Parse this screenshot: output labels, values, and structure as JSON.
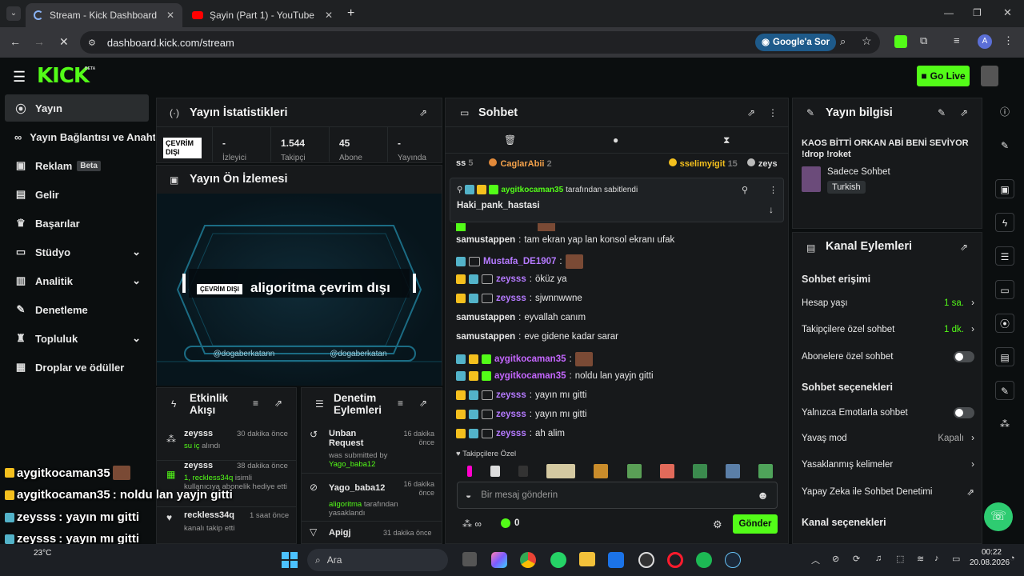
{
  "browser": {
    "tabs": [
      {
        "title": "Stream - Kick Dashboard"
      },
      {
        "title": "Şayin (Part 1) - YouTube"
      }
    ],
    "url": "dashboard.kick.com/stream",
    "google_btn": "Google'a Sor",
    "profile_initial": "A"
  },
  "header": {
    "logo": "KICK",
    "logo_sup": "BETA",
    "go_live": "Go Live"
  },
  "sidebar": {
    "items": [
      {
        "label": "Yayın"
      },
      {
        "label": "Yayın Bağlantısı ve Anahtarı"
      },
      {
        "label": "Reklam",
        "badge": "Beta"
      },
      {
        "label": "Gelir"
      },
      {
        "label": "Başarılar"
      },
      {
        "label": "Stüdyo"
      },
      {
        "label": "Analitik"
      },
      {
        "label": "Denetleme"
      },
      {
        "label": "Topluluk"
      },
      {
        "label": "Droplar ve ödüller"
      }
    ]
  },
  "stats": {
    "title": "Yayın İstatistikleri",
    "status_badge": "ÇEVRİM DIŞI",
    "cells": [
      {
        "value": "-",
        "label": "İzleyici"
      },
      {
        "value": "1.544",
        "label": "Takipçi"
      },
      {
        "value": "45",
        "label": "Abone"
      },
      {
        "value": "-",
        "label": "Yayında"
      }
    ]
  },
  "preview": {
    "title": "Yayın Ön İzlemesi",
    "badge": "ÇEVRİM DIŞI",
    "offline_text": "aligoritma çevrim dışı",
    "social_twitter": "@dogaberkatann",
    "social_instagram": "@dogaberkatan"
  },
  "activity": {
    "title": "Etkinlik Akışı",
    "items": [
      {
        "user": "zeysss",
        "time": "30 dakika önce",
        "desc_green": "su iç",
        "desc": " alındı"
      },
      {
        "user": "zeysss",
        "time": "38 dakika önce",
        "desc_green": "1, reckless34q",
        "desc": " isimli kullanıcıya abonelik hediye etti"
      },
      {
        "user": "reckless34q",
        "time": "1 saat önce",
        "desc_green": "",
        "desc": "kanalı takip etti"
      }
    ]
  },
  "moderation": {
    "title": "Denetim Eylemleri",
    "items": [
      {
        "title": "Unban Request",
        "time": "16 dakika önce",
        "desc": "was submitted by",
        "desc_green": "Yago_baba12"
      },
      {
        "title": "Yago_baba12",
        "time": "16 dakika önce",
        "desc_green": "aligoritma",
        "desc": " tarafından yasaklandı"
      },
      {
        "title": "Apigj",
        "time": "31 dakika önce"
      }
    ]
  },
  "chat": {
    "title": "Sohbet",
    "top_users": [
      {
        "name": "ss",
        "count": "5"
      },
      {
        "name": "CaglarAbii",
        "count": "2"
      },
      {
        "name": "sselimyigit",
        "count": "15"
      },
      {
        "name": "zeys",
        "count": ""
      }
    ],
    "pinned_by": "aygitkocaman35",
    "pinned_suffix": " tarafından sabitlendi",
    "pinned_text": "Haki_pank_hastasi",
    "messages": [
      {
        "user": "samustappen",
        "text": "tam ekran yap lan konsol ekranı ufak",
        "color": "#e6e6e6"
      },
      {
        "user": "Mustafa_DE1907",
        "text": "",
        "color": "#b57aff"
      },
      {
        "user": "zeysss",
        "text": "öküz ya",
        "color": "#b57aff"
      },
      {
        "user": "zeysss",
        "text": "sjwnnwwne",
        "color": "#b57aff"
      },
      {
        "user": "samustappen",
        "text": "eyvallah canım",
        "color": "#e6e6e6"
      },
      {
        "user": "samustappen",
        "text": "eve gidene kadar sarar",
        "color": "#e6e6e6"
      },
      {
        "user": "aygitkocaman35",
        "text": "",
        "color": "#c567ff"
      },
      {
        "user": "aygitkocaman35",
        "text": "noldu lan yayjn gitti",
        "color": "#c567ff"
      },
      {
        "user": "zeysss",
        "text": "yayın mı gitti",
        "color": "#b57aff"
      },
      {
        "user": "zeysss",
        "text": "yayın mı gitti",
        "color": "#b57aff"
      },
      {
        "user": "zeysss",
        "text": "ah alim",
        "color": "#b57aff"
      }
    ],
    "emote_label": "Takipçilere Özel",
    "input_placeholder": "Bir mesaj gönderin",
    "points": "0",
    "send": "Gönder"
  },
  "stream_info": {
    "title": "Yayın bilgisi",
    "stream_title": "KAOS BİTTİ ORKAN ABİ BENİ SEVİYOR !drop !roket",
    "category": "Sadece Sohbet",
    "tag": "Turkish"
  },
  "channel_actions": {
    "title": "Kanal Eylemleri",
    "chat_access": "Sohbet erişimi",
    "rows1": [
      {
        "label": "Hesap yaşı",
        "value": "1 sa."
      },
      {
        "label": "Takipçilere özel sohbet",
        "value": "1 dk."
      },
      {
        "label": "Abonelere özel sohbet",
        "value": ""
      }
    ],
    "chat_options": "Sohbet seçenekleri",
    "rows2": [
      {
        "label": "Yalnızca Emotlarla sohbet",
        "value": ""
      },
      {
        "label": "Yavaş mod",
        "value": "Kapalı"
      },
      {
        "label": "Yasaklanmış kelimeler",
        "value": ""
      },
      {
        "label": "Yapay Zeka ile Sohbet Denetimi",
        "value": ""
      }
    ],
    "channel_options": "Kanal seçenekleri"
  },
  "overlay": {
    "lines": [
      {
        "user": "aygitkocaman35",
        "text": ""
      },
      {
        "user": "aygitkocaman35",
        "text": ": noldu lan yayjn gitti"
      },
      {
        "user": "zeysss",
        "text": ": yayın mı gitti"
      },
      {
        "user": "zeysss",
        "text": ": yayın mı gitti"
      },
      {
        "user": "zeysss",
        "text": ": ah alim"
      }
    ]
  },
  "taskbar": {
    "weather": "23°C",
    "search": "Ara",
    "time": "00:22",
    "date": "20.08.2026"
  }
}
